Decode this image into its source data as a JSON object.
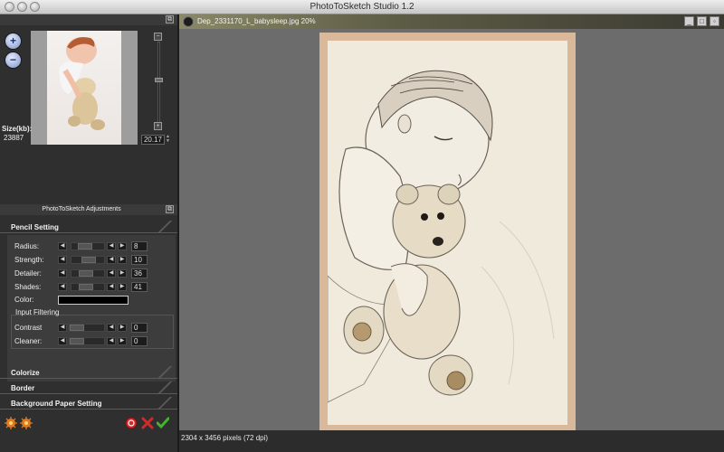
{
  "app": {
    "title": "PhotoToSketch Studio 1.2"
  },
  "preview": {
    "size_label": "Size(kb):",
    "size_value": "23887",
    "zoom_value": "20.17"
  },
  "adjustments": {
    "title": "PhotoToSketch Adjustments",
    "pencil_setting": {
      "header": "Pencil Setting",
      "rows": [
        {
          "label": "Radius:",
          "value": "8",
          "position": 0.35
        },
        {
          "label": "Strength:",
          "value": "10",
          "position": 0.55
        },
        {
          "label": "Detailer:",
          "value": "36",
          "position": 0.42
        },
        {
          "label": "Shades:",
          "value": "41",
          "position": 0.42
        }
      ],
      "color_label": "Color:",
      "color_value": "#000000"
    },
    "input_filtering": {
      "header": "Input Filtering",
      "rows": [
        {
          "label": "Contrast",
          "value": "0",
          "position": 0.0
        },
        {
          "label": "Cleaner:",
          "value": "0",
          "position": 0.0
        }
      ]
    },
    "sections": [
      "Colorize",
      "Border",
      "Background Paper Setting"
    ]
  },
  "document": {
    "tab_title": "Dep_2331170_L_babysleep.jpg 20%",
    "status": "2304 x 3456 pixels (72 dpi)"
  },
  "colors": {
    "accent_tab": "#5d5c45",
    "paper_border": "#d9b99a",
    "sketch_bg": "#efeadb"
  }
}
